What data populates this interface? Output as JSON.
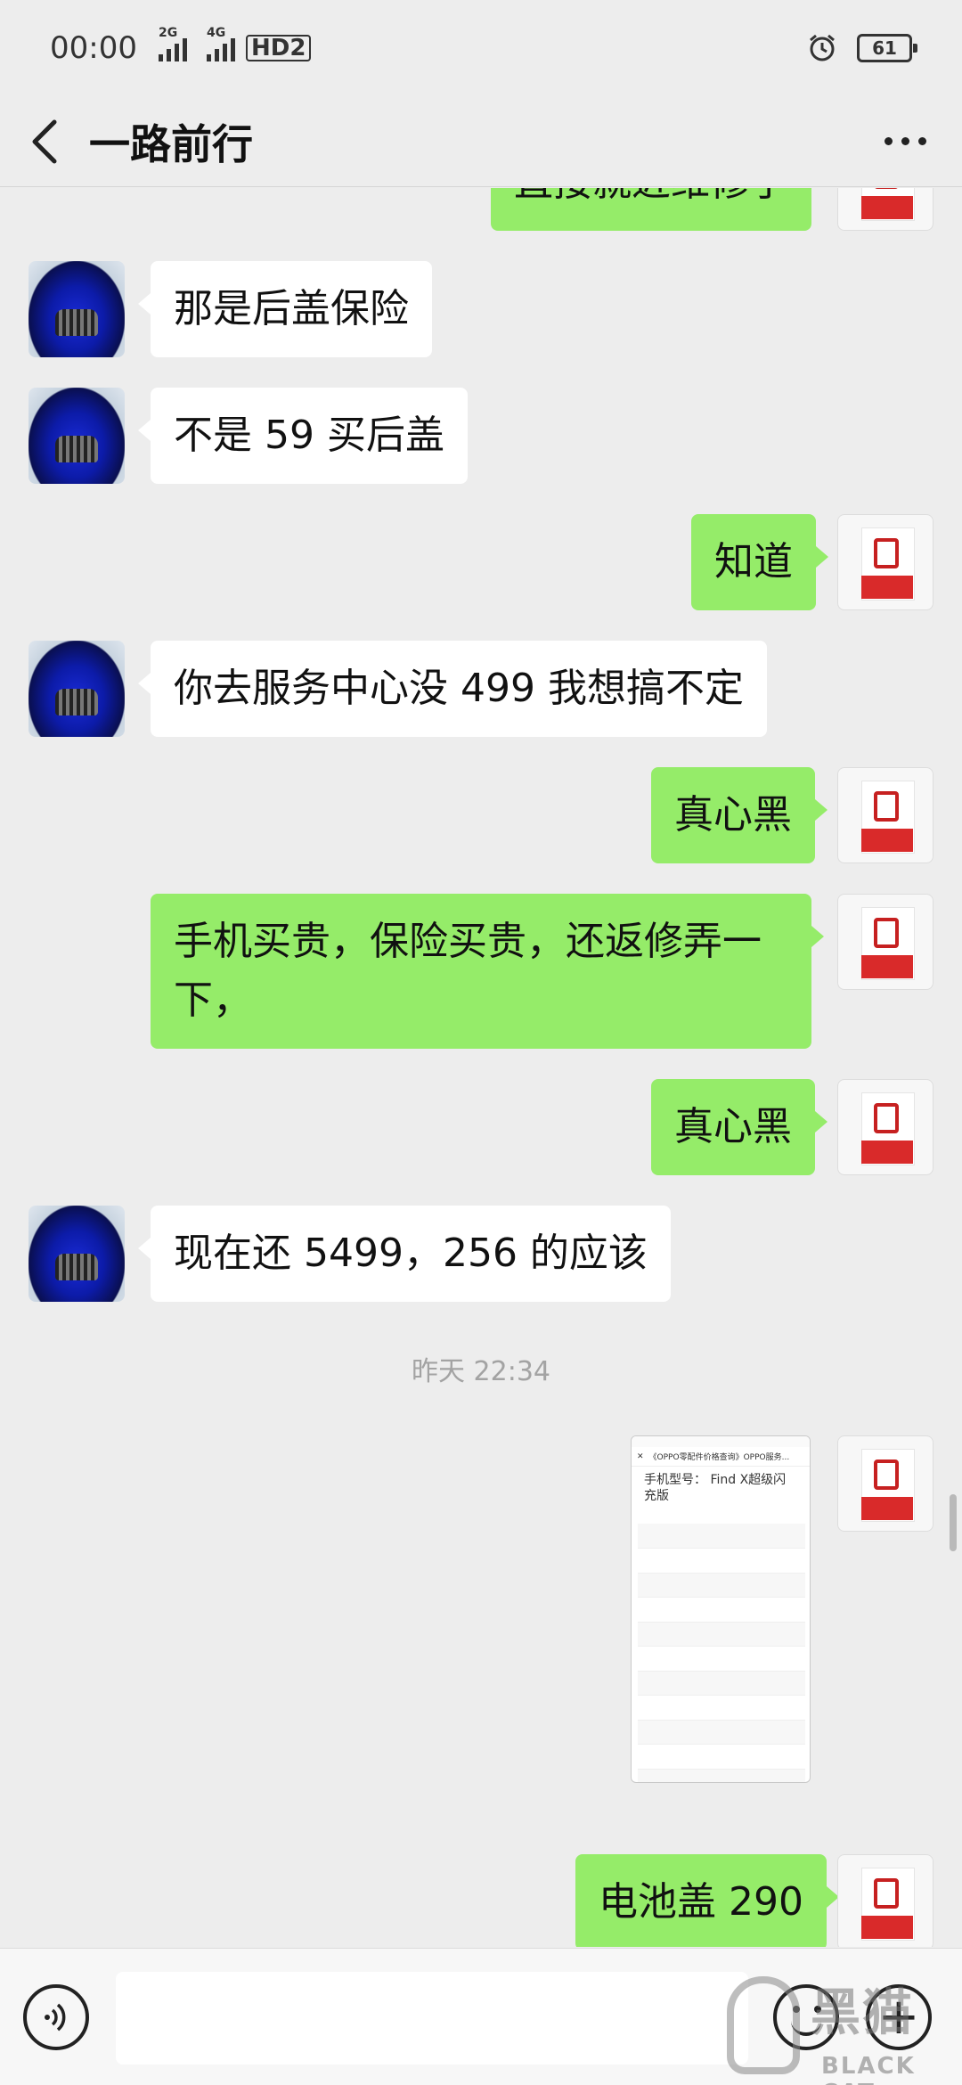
{
  "status_bar": {
    "time": "00:00",
    "net1": "2G",
    "net2": "4G",
    "hd": "HD2",
    "battery": "61"
  },
  "header": {
    "title": "一路前行"
  },
  "messages": [
    {
      "side": "out",
      "text": "直接就近维修了"
    },
    {
      "side": "in",
      "text": "那是后盖保险"
    },
    {
      "side": "in",
      "text": "不是 59 买后盖"
    },
    {
      "side": "out",
      "text": "知道"
    },
    {
      "side": "in",
      "text": "你去服务中心没 499 我想搞不定"
    },
    {
      "side": "out",
      "text": "真心黑"
    },
    {
      "side": "out",
      "text": "手机买贵，保险买贵，还返修弄一下，"
    },
    {
      "side": "out",
      "text": "真心黑"
    },
    {
      "side": "in",
      "text": "现在还 5499，256 的应该"
    },
    {
      "side": "out",
      "text": "电池盖 290"
    }
  ],
  "timestamp": "昨天 22:34",
  "screenshot_message": {
    "header": "《OPPO零配件价格查询》OPPO服务...",
    "model_label": "手机型号： Find X超级闪充版"
  },
  "watermark": {
    "brand_cn": "黑猫",
    "brand_en": "BLACK CAT"
  },
  "icons": {
    "back": "chevron-left-icon",
    "more": "more-dots-icon",
    "voice": "voice-icon",
    "emoji": "emoji-icon",
    "plus": "plus-icon",
    "alarm": "alarm-icon"
  },
  "colors": {
    "background": "#ededed",
    "outgoing_bubble": "#95ec69",
    "incoming_bubble": "#ffffff",
    "timestamp": "#a3a3a3"
  }
}
